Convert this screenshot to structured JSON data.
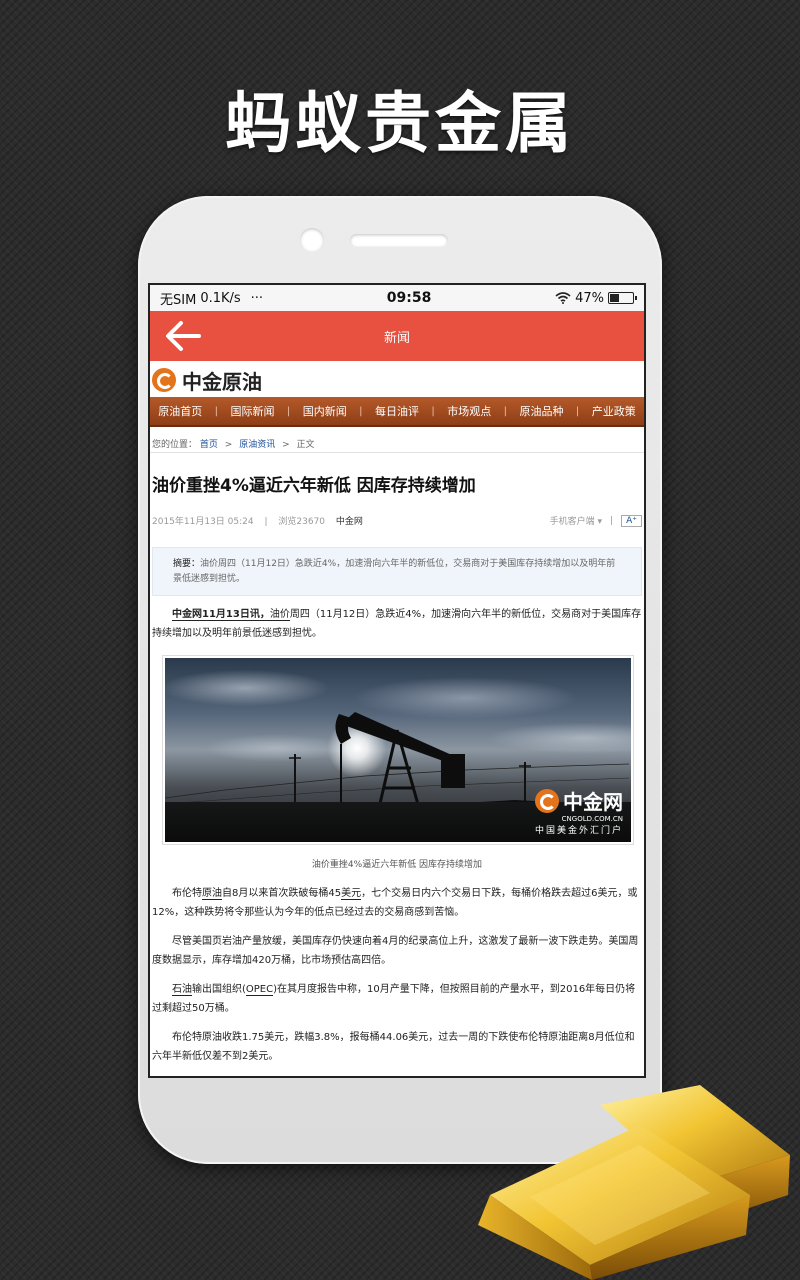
{
  "promo": {
    "title": "蚂蚁贵金属"
  },
  "status_bar": {
    "carrier": "无SIM",
    "speed": "0.1K/s",
    "dots": "···",
    "time": "09:58",
    "battery": "47%",
    "battery_level": 0.47
  },
  "nav": {
    "title": "新闻",
    "back_icon": "arrow-left-icon"
  },
  "site": {
    "logo_text": "中金原油"
  },
  "categories": [
    {
      "label": "原油首页"
    },
    {
      "label": "国际新闻"
    },
    {
      "label": "国内新闻"
    },
    {
      "label": "每日油评"
    },
    {
      "label": "市场观点"
    },
    {
      "label": "原油品种"
    },
    {
      "label": "产业政策"
    }
  ],
  "breadcrumb": {
    "prefix": "您的位置：",
    "home": "首页",
    "sep1": ">",
    "section": "原油资讯",
    "sep2": ">",
    "current": "正文"
  },
  "article": {
    "title": "油价重挫4%逼近六年新低 因库存持续增加",
    "date": "2015年11月13日 05:24",
    "sep": "|",
    "views": "浏览23670",
    "source": "中金网",
    "mobile_client": "手机客户端",
    "mobile_sep": "|",
    "font_button": "A⁺",
    "summary_label": "摘要：",
    "summary": "油价周四（11月12日）急跌近4%，加速滑向六年半的新低位，交易商对于美国库存持续增加以及明年前景低迷感到担忧。",
    "p1_lead": "中金网11月13日讯，",
    "p1_kw": "油价",
    "p1_rest": "周四（11月12日）急跌近4%，加速滑向六年半的新低位，交易商对于美国库存持续增加以及明年前景低迷感到担忧。",
    "photo_brand": "中金网",
    "photo_domain": "CNGOLD.COM.CN",
    "photo_tagline": "中国美金外汇门户",
    "caption": "油价重挫4%逼近六年新低 因库存持续增加",
    "p2_a": "布伦特",
    "p2_kw1": "原油",
    "p2_b": "自8月以来首次跌破每桶45",
    "p2_kw2": "美元",
    "p2_c": "，七个交易日内六个交易日下跌，每桶价格跌去超过6美元，或12%，这种跌势将令那些认为今年的低点已经过去的交易商感到苦恼。",
    "p3": "尽管美国页岩油产量放缓，美国库存仍快速向着4月的纪录高位上升，这激发了最新一波下跌走势。美国周度数据显示，库存增加420万桶，比市场预估高四倍。",
    "p4_kw1": "石油",
    "p4_a": "输出国组织(",
    "p4_kw2": "OPEC",
    "p4_b": ")在其月度报告中称，10月产量下降，但按照目前的产量水平，到2016年每日仍将过剩超过50万桶。",
    "p5": "布伦特原油收跌1.75美元，跌幅3.8%，报每桶44.06美元，过去一周的下跌使布伦特原油距离8月低位和六年半新低仅差不到2美元。"
  },
  "colors": {
    "nav_red": "#e8503f",
    "category_brown": "#a24b1f",
    "link_blue": "#1a4e99",
    "logo_orange": "#e3741c"
  }
}
